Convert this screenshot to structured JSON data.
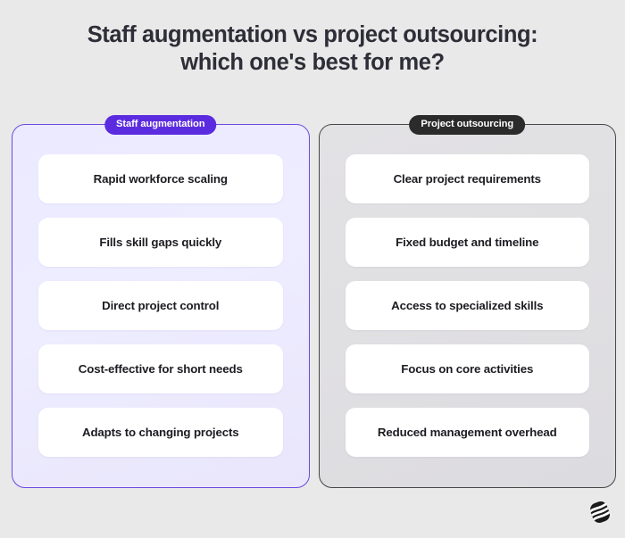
{
  "page": {
    "background_color": "#e9e9e9",
    "title_line_1": "Staff augmentation vs project outsourcing:",
    "title_line_2": "which one's best for me?",
    "title_color": "#2e2e38"
  },
  "columns": [
    {
      "id": "staff-augmentation",
      "badge_label": "Staff augmentation",
      "badge_color": "#5b2be0",
      "badge_text_color": "#ffffff",
      "border_color": "#6c4ae0",
      "fill_color": "#eceaff",
      "cards": [
        {
          "label": "Rapid workforce scaling"
        },
        {
          "label": "Fills skill gaps quickly"
        },
        {
          "label": "Direct project control"
        },
        {
          "label": "Cost-effective for short needs"
        },
        {
          "label": "Adapts to changing projects"
        }
      ]
    },
    {
      "id": "project-outsourcing",
      "badge_label": "Project outsourcing",
      "badge_color": "#2b2b2b",
      "badge_text_color": "#ffffff",
      "border_color": "#474747",
      "fill_color": "#e0dfe2",
      "cards": [
        {
          "label": "Clear project requirements"
        },
        {
          "label": "Fixed budget and timeline"
        },
        {
          "label": "Access to specialized skills"
        },
        {
          "label": "Focus on core activities"
        },
        {
          "label": "Reduced management overhead"
        }
      ]
    }
  ],
  "logo": {
    "icon": "stylized-s-logo",
    "color": "#1a1a1a"
  }
}
